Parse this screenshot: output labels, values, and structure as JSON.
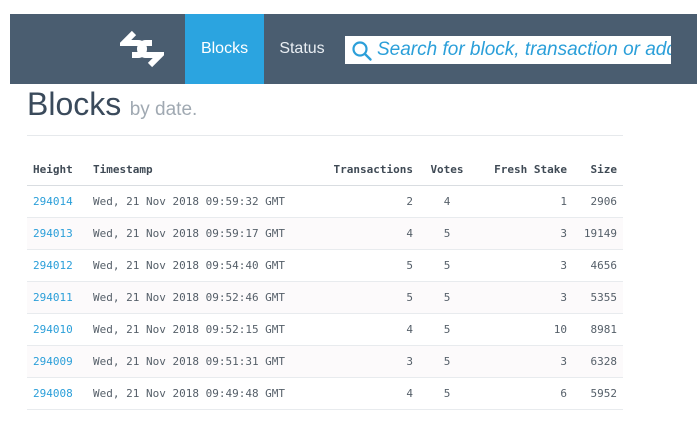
{
  "nav": {
    "blocks_label": "Blocks",
    "status_label": "Status"
  },
  "search": {
    "placeholder": "Search for block, transaction or address"
  },
  "page": {
    "title": "Blocks",
    "subtitle": "by date."
  },
  "table": {
    "headers": {
      "height": "Height",
      "timestamp": "Timestamp",
      "transactions": "Transactions",
      "votes": "Votes",
      "fresh_stake": "Fresh Stake",
      "size": "Size"
    },
    "rows": [
      {
        "height": "294014",
        "timestamp": "Wed, 21 Nov 2018 09:59:32 GMT",
        "transactions": "2",
        "votes": "4",
        "fresh_stake": "1",
        "size": "2906"
      },
      {
        "height": "294013",
        "timestamp": "Wed, 21 Nov 2018 09:59:17 GMT",
        "transactions": "4",
        "votes": "5",
        "fresh_stake": "3",
        "size": "19149"
      },
      {
        "height": "294012",
        "timestamp": "Wed, 21 Nov 2018 09:54:40 GMT",
        "transactions": "5",
        "votes": "5",
        "fresh_stake": "3",
        "size": "4656"
      },
      {
        "height": "294011",
        "timestamp": "Wed, 21 Nov 2018 09:52:46 GMT",
        "transactions": "5",
        "votes": "5",
        "fresh_stake": "3",
        "size": "5355"
      },
      {
        "height": "294010",
        "timestamp": "Wed, 21 Nov 2018 09:52:15 GMT",
        "transactions": "4",
        "votes": "5",
        "fresh_stake": "10",
        "size": "8981"
      },
      {
        "height": "294009",
        "timestamp": "Wed, 21 Nov 2018 09:51:31 GMT",
        "transactions": "3",
        "votes": "5",
        "fresh_stake": "3",
        "size": "6328"
      },
      {
        "height": "294008",
        "timestamp": "Wed, 21 Nov 2018 09:49:48 GMT",
        "transactions": "4",
        "votes": "5",
        "fresh_stake": "6",
        "size": "5952"
      }
    ]
  },
  "colors": {
    "topbar": "#4a5d70",
    "active_tab": "#2ba4e0",
    "link": "#2b9fd9"
  },
  "icons": {
    "logo": "decred-logo-icon",
    "search": "search-icon"
  }
}
